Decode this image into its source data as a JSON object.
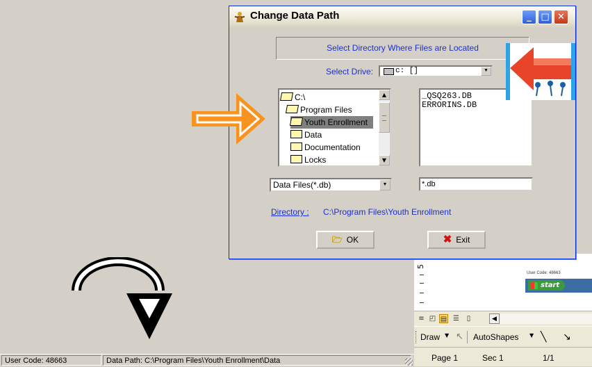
{
  "dialog": {
    "title": "Change Data Path",
    "header": "Select Directory Where Files are Located",
    "drive_label": "Select Drive:",
    "drive_value": "c: []",
    "directories": [
      {
        "name": "C:\\",
        "state": "open"
      },
      {
        "name": "Program Files",
        "state": "open"
      },
      {
        "name": "Youth Enrollment",
        "state": "open-selected"
      },
      {
        "name": "Data",
        "state": "closed"
      },
      {
        "name": "Documentation",
        "state": "closed"
      },
      {
        "name": "Locks",
        "state": "closed"
      }
    ],
    "files": [
      "_QSQ263.DB",
      "ERRORINS.DB"
    ],
    "file_filter": "Data Files(*.db)",
    "file_pattern": "*.db",
    "directory_label": "Directory :",
    "directory_value": "C:\\Program Files\\Youth Enrollment",
    "ok_label": "OK",
    "exit_label": "Exit"
  },
  "status_bar": {
    "user_code": "User Code:  48663",
    "data_path": "Data Path:  C:\\Program Files\\Youth Enrollment\\Data"
  },
  "word_window": {
    "ruler_number": "5",
    "thumbnail_user_code": "User Code: 48663",
    "thumbnail_start": "start",
    "draw_label": "Draw",
    "autoshapes_label": "AutoShapes",
    "page": "Page  1",
    "section": "Sec  1",
    "page_fraction": "1/1"
  },
  "colors": {
    "dialog_text_blue": "#1a2fd8",
    "title_bar_blue": "#0831d9",
    "close_red": "#c1391b",
    "highlight_arrow_orange": "#f7931e"
  }
}
